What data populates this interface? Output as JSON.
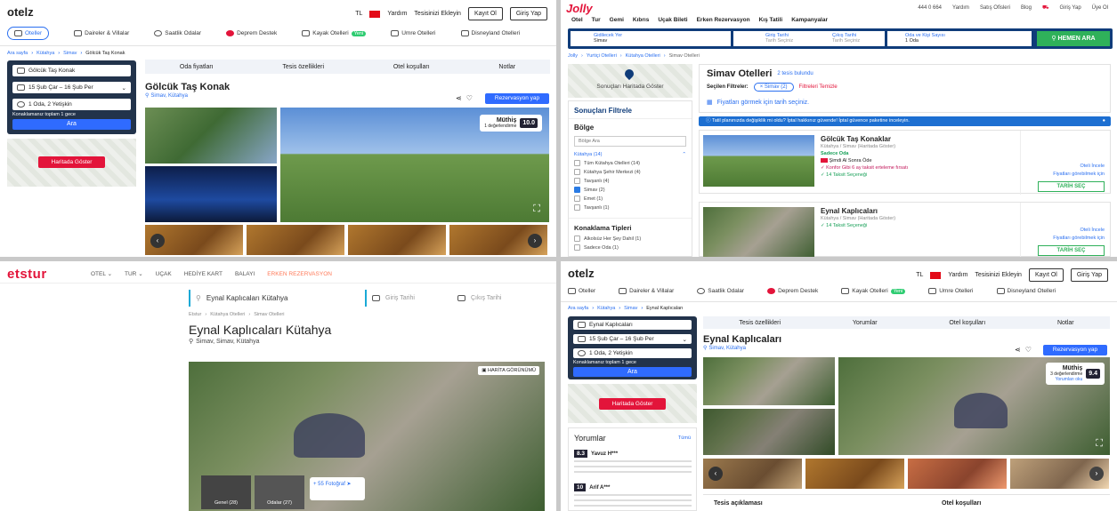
{
  "q1": {
    "logo": "otelz",
    "currency": "TL",
    "help": "Yardım",
    "add_property": "Tesisinizi Ekleyin",
    "register": "Kayıt Ol",
    "login": "Giriş Yap",
    "nav": [
      "Oteller",
      "Daireler & Villalar",
      "Saatlik Odalar",
      "Deprem Destek",
      "Kayak Otelleri",
      "Umre Otelleri",
      "Disneyland Otelleri"
    ],
    "new_badge": "Yeni",
    "breadcrumb": [
      "Ara sayfa",
      "Kütahya",
      "Simav",
      "Gölcük Taş Konak"
    ],
    "search": {
      "place": "Gölcük Taş Konak",
      "dates": "15 Şub Çar – 16 Şub Per",
      "guests": "1 Oda, 2 Yetişkin",
      "note": "Konaklamanız toplam 1 gece",
      "button": "Ara"
    },
    "map_button": "Haritada Göster",
    "tabs": [
      "Oda fiyatları",
      "Tesis özellikleri",
      "Otel koşulları",
      "Notlar"
    ],
    "title": "Gölcük Taş Konak",
    "location": "Simav, Kütahya",
    "reserve": "Rezervasyon yap",
    "rating": {
      "label": "Müthiş",
      "sub": "1 değerlendirme",
      "score": "10.0"
    }
  },
  "q2": {
    "logo": "Jolly",
    "phone": "444 0 664",
    "help": "Yardım",
    "offices": "Satış Ofisleri",
    "blog": "Blog",
    "login": "Giriş Yap",
    "member": "Üye Ol",
    "nav": [
      "Otel",
      "Tur",
      "Gemi",
      "Kıbrıs",
      "Uçak Bileti",
      "Erken Rezervasyon",
      "Kış Tatili",
      "Kampanyalar"
    ],
    "search": {
      "f1_label": "Gidilecek Yer",
      "f1": "Simav",
      "f2_label": "Giriş Tarihi",
      "f2": "Tarih Seçiniz",
      "f3_label": "Çıkış Tarihi",
      "f3": "Tarih Seçiniz",
      "f4_label": "Oda ve Kişi Sayısı",
      "f4": "1 Oda",
      "button": "HEMEN ARA"
    },
    "breadcrumb": [
      "Jolly",
      "Yurtiçi Otelleri",
      "Kütahya Otelleri",
      "Simav Otelleri"
    ],
    "map_button": "Sonuçları Haritada Göster",
    "filter_title": "Sonuçları Filtrele",
    "region_title": "Bölge",
    "region_placeholder": "Bölge Ara",
    "regions": [
      {
        "name": "Kütahya (14)",
        "on": false
      },
      {
        "name": "Tüm Kütahya Otelleri (14)",
        "on": false
      },
      {
        "name": "Kütahya Şehir Merkezi (4)",
        "on": false
      },
      {
        "name": "Tavşanlı (4)",
        "on": false
      },
      {
        "name": "Simav (2)",
        "on": true
      },
      {
        "name": "Emet (1)",
        "on": false
      },
      {
        "name": "Tavşanlı (1)",
        "on": false
      }
    ],
    "acc_title": "Konaklama Tipleri",
    "acc": [
      "Alkolsüz Her Şey Dahil (1)",
      "Sadece Oda (1)"
    ],
    "list_title": "Simav Otelleri",
    "count": "2 tesis bulundu",
    "chosen_label": "Seçilen Filtreler:",
    "chosen_tag": "Simav (2)",
    "clear": "Filtreleri Temizle",
    "price_note": "Fiyatları görmek için tarih seçiniz.",
    "banner": "Tatil planınızda değişiklik mi oldu? İptal hakkınız güvende! İptal güvence paketine inceleyin.",
    "hotels": [
      {
        "name": "Gölcük Taş Konaklar",
        "loc": "Kütahya / Simav (Haritada Göster)",
        "board": "Sadece Oda",
        "l1": "Şimdi Al Sonra Öde",
        "l2": "Konfor Gibi 6 ay taksit erteleme fırsatı",
        "l3": "14 Taksit Seçeneği",
        "link": "Oteli İncele",
        "p1": "Fiyatları görebilmek için",
        "btn": "TARİH SEÇ"
      },
      {
        "name": "Eynal Kaplıcaları",
        "loc": "Kütahya / Simav (Haritada Göster)",
        "l3": "14 Taksit Seçeneği",
        "link": "Oteli İncele",
        "p1": "Fiyatları görebilmek için",
        "btn": "TARİH SEÇ"
      }
    ]
  },
  "q3": {
    "logo": "etstur",
    "nav": [
      "OTEL",
      "TUR",
      "UÇAK",
      "HEDİYE KART",
      "BALAYI",
      "ERKEN REZERVASYON"
    ],
    "search": "Eynal Kaplıcaları Kütahya",
    "checkin": "Giriş Tarihi",
    "checkout": "Çıkış Tarihi",
    "breadcrumb": [
      "Etstur",
      "Kütahya Otelleri",
      "Simav Otelleri"
    ],
    "title": "Eynal Kaplıcaları Kütahya",
    "location": "Simav, Simav, Kütahya",
    "map_view": "HARİTA GÖRÜNÜMÜ",
    "thumbs": [
      "Genel (28)",
      "Odalar (27)"
    ],
    "more": "+ 55 Fotoğraf"
  },
  "q4": {
    "logo": "otelz",
    "currency": "TL",
    "help": "Yardım",
    "add_property": "Tesisinizi Ekleyin",
    "register": "Kayıt Ol",
    "login": "Giriş Yap",
    "nav": [
      "Oteller",
      "Daireler & Villalar",
      "Saatlik Odalar",
      "Deprem Destek",
      "Kayak Otelleri",
      "Umre Otelleri",
      "Disneyland Otelleri"
    ],
    "new_badge": "Yeni",
    "breadcrumb": [
      "Ara sayfa",
      "Kütahya",
      "Simav",
      "Eynal Kaplıcaları"
    ],
    "search": {
      "place": "Eynal Kaplıcaları",
      "dates": "15 Şub Çar – 16 Şub Per",
      "guests": "1 Oda, 2 Yetişkin",
      "note": "Konaklamanız toplam 1 gece",
      "button": "Ara"
    },
    "map_button": "Haritada Göster",
    "tabs": [
      "Tesis özellikleri",
      "Yorumlar",
      "Otel koşulları",
      "Notlar"
    ],
    "title": "Eynal Kaplıcaları",
    "location": "Simav, Kütahya",
    "reserve": "Rezervasyon yap",
    "rating": {
      "label": "Müthiş",
      "sub": "3 değerlendirme",
      "link": "Yorumları oku",
      "score": "9.4"
    },
    "reviews_title": "Yorumlar",
    "reviews_all": "Tümü",
    "reviews": [
      {
        "score": "8.3",
        "name": "Yavuz H***",
        "text": "Kapalı havuz..."
      },
      {
        "score": "10",
        "name": "Arif A***",
        "text": "Tesis ..."
      }
    ],
    "desc_title": "Tesis açıklaması",
    "cond_title": "Otel koşulları"
  }
}
